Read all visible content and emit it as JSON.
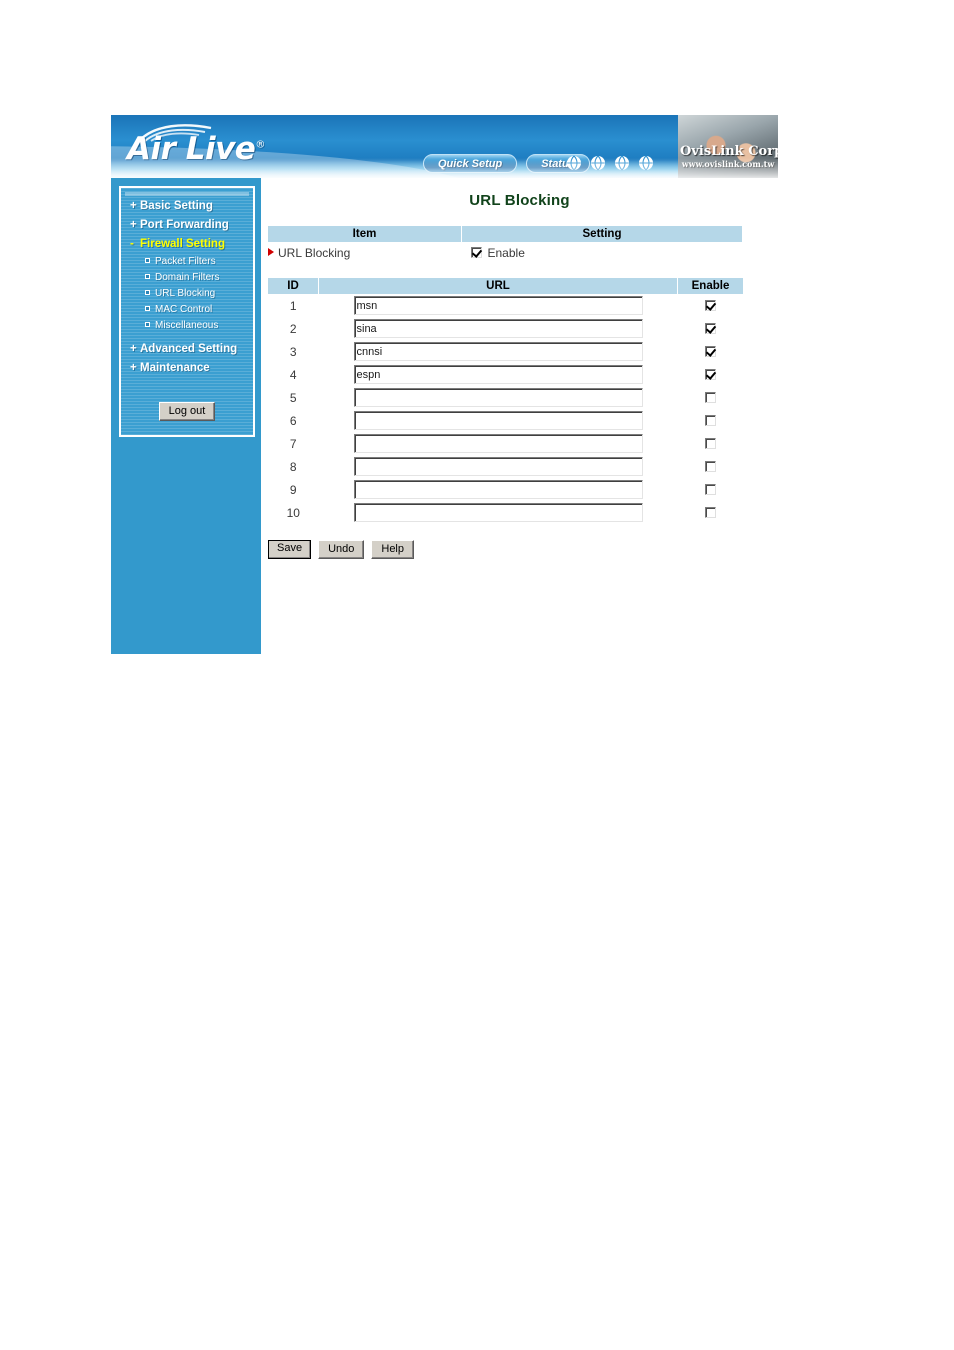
{
  "brand": {
    "logo_text": "Air Live",
    "logo_registered": "®",
    "corp_name": "OvisLink Corp.",
    "corp_url": "www.ovislink.com.tw",
    "accent_blue": "#3399cc",
    "header_band": "#b5d7e8",
    "title_green": "#11431b",
    "active_yellow": "#ffff00"
  },
  "header": {
    "pills": [
      {
        "label": "Quick Setup",
        "name": "quick-setup"
      },
      {
        "label": "Status",
        "name": "status"
      }
    ],
    "globe_icons": [
      "globe-icon",
      "globe-icon",
      "globe-icon",
      "globe-icon"
    ]
  },
  "sidebar": {
    "groups": [
      {
        "toggle": "+",
        "label": "Basic Setting",
        "active": false,
        "name": "basic-setting"
      },
      {
        "toggle": "+",
        "label": "Port Forwarding",
        "active": false,
        "name": "port-forwarding"
      },
      {
        "toggle": "-",
        "label": "Firewall Setting",
        "active": true,
        "name": "firewall-setting"
      }
    ],
    "submenu": [
      {
        "label": "Packet Filters",
        "name": "packet-filters"
      },
      {
        "label": "Domain Filters",
        "name": "domain-filters"
      },
      {
        "label": "URL Blocking",
        "name": "url-blocking"
      },
      {
        "label": "MAC Control",
        "name": "mac-control"
      },
      {
        "label": "Miscellaneous",
        "name": "miscellaneous"
      }
    ],
    "groups_after": [
      {
        "toggle": "+",
        "label": "Advanced Setting",
        "active": false,
        "name": "advanced-setting"
      },
      {
        "toggle": "+",
        "label": "Maintenance",
        "active": false,
        "name": "maintenance"
      }
    ],
    "logout_label": "Log out"
  },
  "main": {
    "title": "URL Blocking",
    "item_table": {
      "headers": {
        "item": "Item",
        "setting": "Setting"
      },
      "row": {
        "item_label": "URL Blocking",
        "checkbox_label": "Enable",
        "checked": true
      }
    },
    "url_table": {
      "headers": {
        "id": "ID",
        "url": "URL",
        "enable": "Enable"
      },
      "rows": [
        {
          "id": "1",
          "url": "msn",
          "enabled": true
        },
        {
          "id": "2",
          "url": "sina",
          "enabled": true
        },
        {
          "id": "3",
          "url": "cnnsi",
          "enabled": true
        },
        {
          "id": "4",
          "url": "espn",
          "enabled": true
        },
        {
          "id": "5",
          "url": "",
          "enabled": false
        },
        {
          "id": "6",
          "url": "",
          "enabled": false
        },
        {
          "id": "7",
          "url": "",
          "enabled": false
        },
        {
          "id": "8",
          "url": "",
          "enabled": false
        },
        {
          "id": "9",
          "url": "",
          "enabled": false
        },
        {
          "id": "10",
          "url": "",
          "enabled": false
        }
      ]
    },
    "buttons": [
      {
        "label": "Save",
        "name": "save-button",
        "focused": true
      },
      {
        "label": "Undo",
        "name": "undo-button",
        "focused": false
      },
      {
        "label": "Help",
        "name": "help-button",
        "focused": false
      }
    ]
  }
}
